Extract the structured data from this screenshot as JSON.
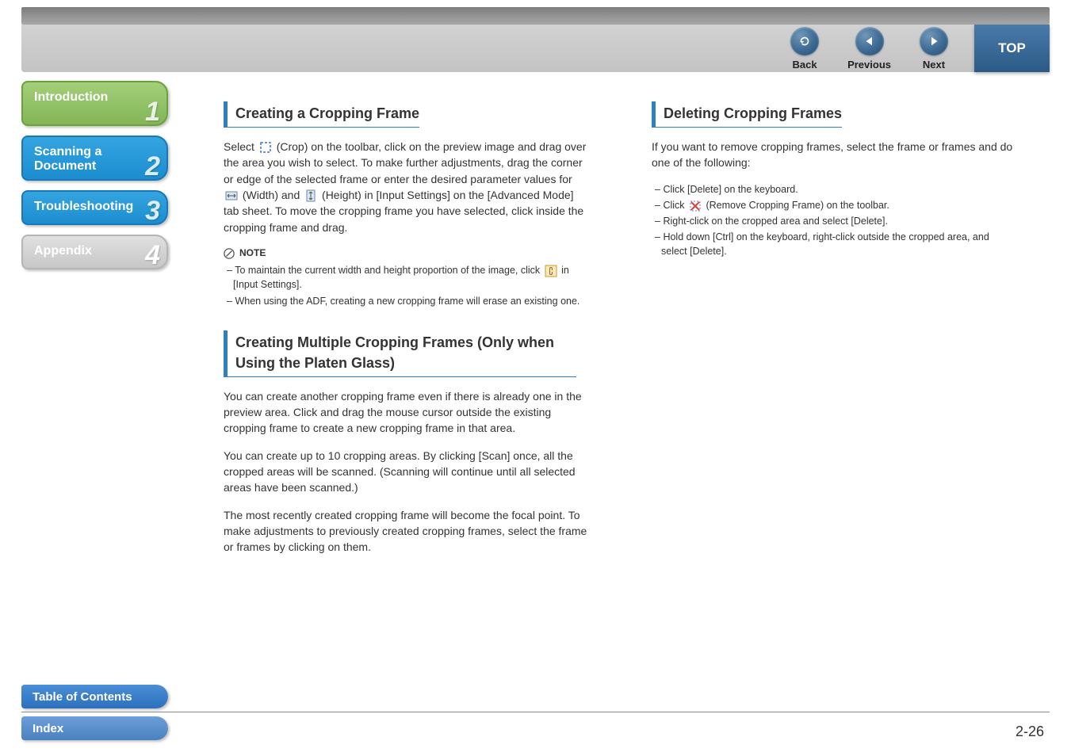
{
  "header": {
    "back": "Back",
    "previous": "Previous",
    "next": "Next",
    "top": "TOP"
  },
  "sidebar": {
    "intro": "Introduction",
    "scan": "Scanning a Document",
    "trouble": "Troubleshooting",
    "appendix": "Appendix",
    "n1": "1",
    "n2": "2",
    "n3": "3",
    "n4": "4",
    "toc": "Table of Contents",
    "index": "Index"
  },
  "page_number": "2-26",
  "left": {
    "h1": "Creating a Cropping Frame",
    "p1a": "Select ",
    "p1b": " (Crop) on the toolbar, click on the preview image and drag over the area you wish to select. To make further adjustments, drag the corner or edge of the selected frame or enter the desired parameter values for ",
    "p1c": " (Width) and ",
    "p1d": " (Height) in [Input Settings] on the [Advanced Mode] tab sheet. To move the cropping frame you have selected, click inside the cropping frame and drag.",
    "note_label": "NOTE",
    "note1a": "To maintain the current width and height proportion of the image, click ",
    "note1b": " in [Input Settings].",
    "note2": "When using the ADF, creating a new cropping frame will erase an existing one.",
    "h2": "Creating Multiple Cropping Frames (Only when Using the Platen Glass)",
    "p2": "You can create another cropping frame even if there is already one in the preview area. Click and drag the mouse cursor outside the existing cropping frame to create a new cropping frame in that area.",
    "p3": "You can create up to 10 cropping areas. By clicking [Scan] once, all the cropped areas will be scanned. (Scanning will continue until all selected areas have been scanned.)",
    "p4": "The most recently created cropping frame will become the focal point. To make adjustments to previously created cropping frames, select the frame or frames by clicking on them."
  },
  "right": {
    "h1": "Deleting Cropping Frames",
    "p1": "If you want to remove cropping frames, select the frame or frames and do one of the following:",
    "b1": "Click [Delete] on the keyboard.",
    "b2a": "Click ",
    "b2b": " (Remove Cropping Frame) on the toolbar.",
    "b3": "Right-click on the cropped area and select [Delete].",
    "b4": "Hold down [Ctrl] on the keyboard, right-click outside the cropped area, and select [Delete]."
  }
}
